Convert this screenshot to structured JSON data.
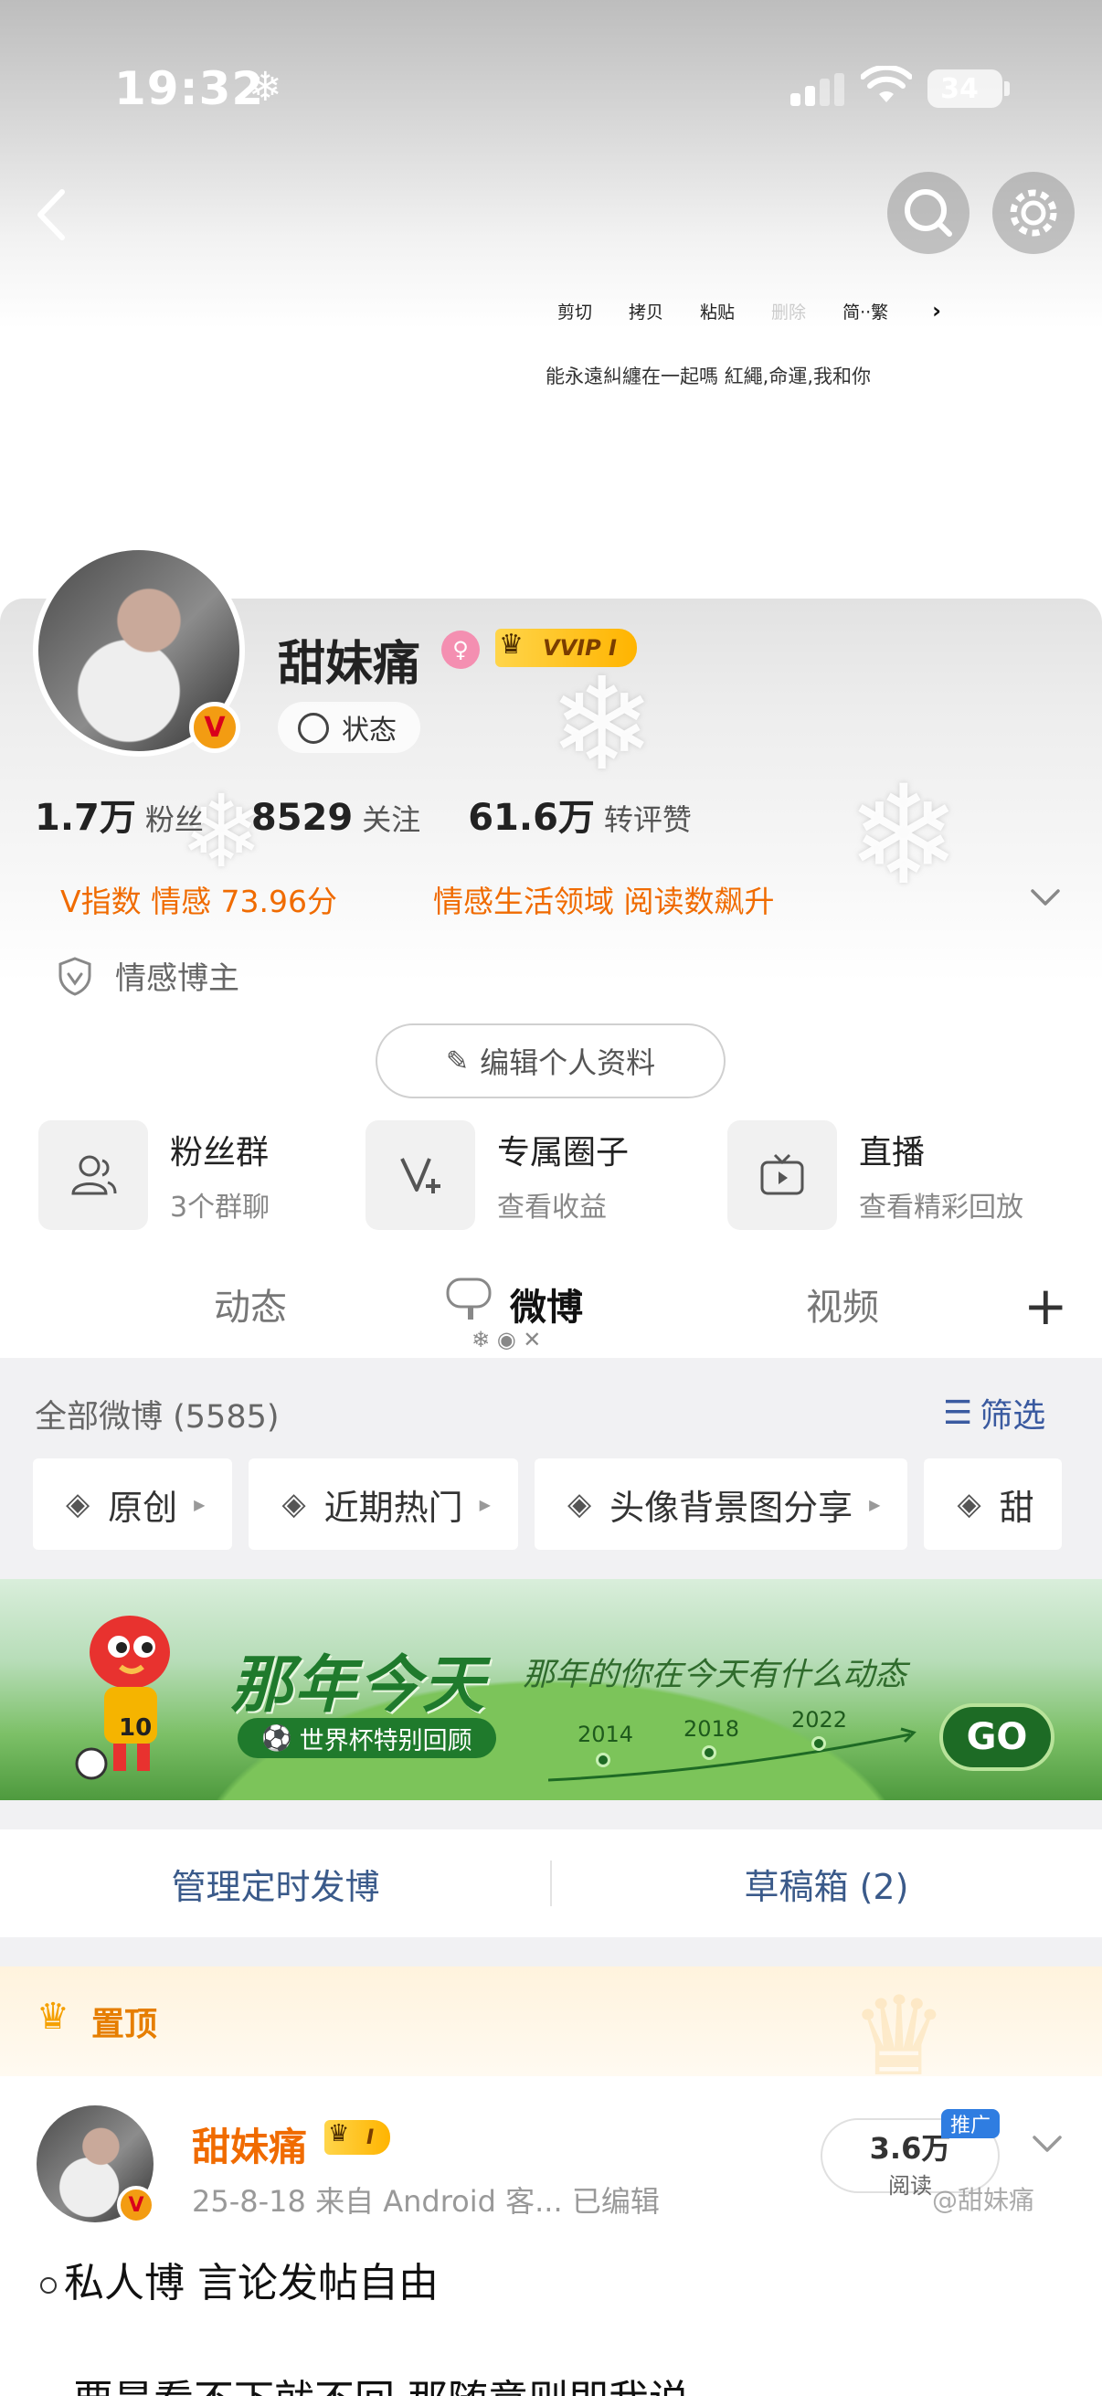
{
  "status_bar": {
    "time": "19:32",
    "battery": "34"
  },
  "context_menu": {
    "items": [
      "剪切",
      "拷贝",
      "粘贴",
      "删除",
      "简··繁"
    ],
    "selected_text": "能永遠糾纏在一起嗎  紅繩,命運,我和你"
  },
  "profile": {
    "name": "甜妹痛",
    "vip_label": "VVIP I",
    "status_label": "状态",
    "stats": {
      "fans_num": "1.7万",
      "fans_label": "粉丝",
      "follow_num": "8529",
      "follow_label": "关注",
      "likes_num": "61.6万",
      "likes_label": "转评赞"
    },
    "vindex": "V指数 情感 73.96分",
    "domain_text": "情感生活领域 阅读数飙升",
    "blogger_tag": "情感博主",
    "edit_label": "编辑个人资料"
  },
  "features": [
    {
      "title": "粉丝群",
      "sub": "3个群聊"
    },
    {
      "title": "专属圈子",
      "sub": "查看收益"
    },
    {
      "title": "直播",
      "sub": "查看精彩回放"
    }
  ],
  "tabs": {
    "dynamic": "动态",
    "weibo": "微博",
    "video": "视频"
  },
  "filter": {
    "all_label": "全部微博 (5585)",
    "filter_label": "筛选",
    "chips": [
      "原创",
      "近期热门",
      "头像背景图分享",
      "甜"
    ]
  },
  "banner": {
    "title": "那年今天",
    "subtitle": "那年的你在今天有什么动态",
    "pill": "世界杯特别回顾",
    "years": [
      "2014",
      "2018",
      "2022"
    ],
    "go_label": "GO",
    "mascot_number": "10"
  },
  "actions": {
    "schedule": "管理定时发博",
    "drafts": "草稿箱 (2)"
  },
  "pinned": {
    "label": "置顶"
  },
  "post": {
    "author": "甜妹痛",
    "vip": "I",
    "meta": "25-8-18  来自 Android 客...  已编辑",
    "reads": "3.6万",
    "reads_label": "阅读",
    "promo": "推广",
    "text": "私人博 言论发帖自由",
    "text2": "要是看不下就不回 那随意则即我说",
    "watermark": "@甜妹痛"
  },
  "colors": {
    "accent_orange": "#f06b00",
    "link_blue": "#3a5a8a",
    "vip_gold": "#ffc21f"
  }
}
